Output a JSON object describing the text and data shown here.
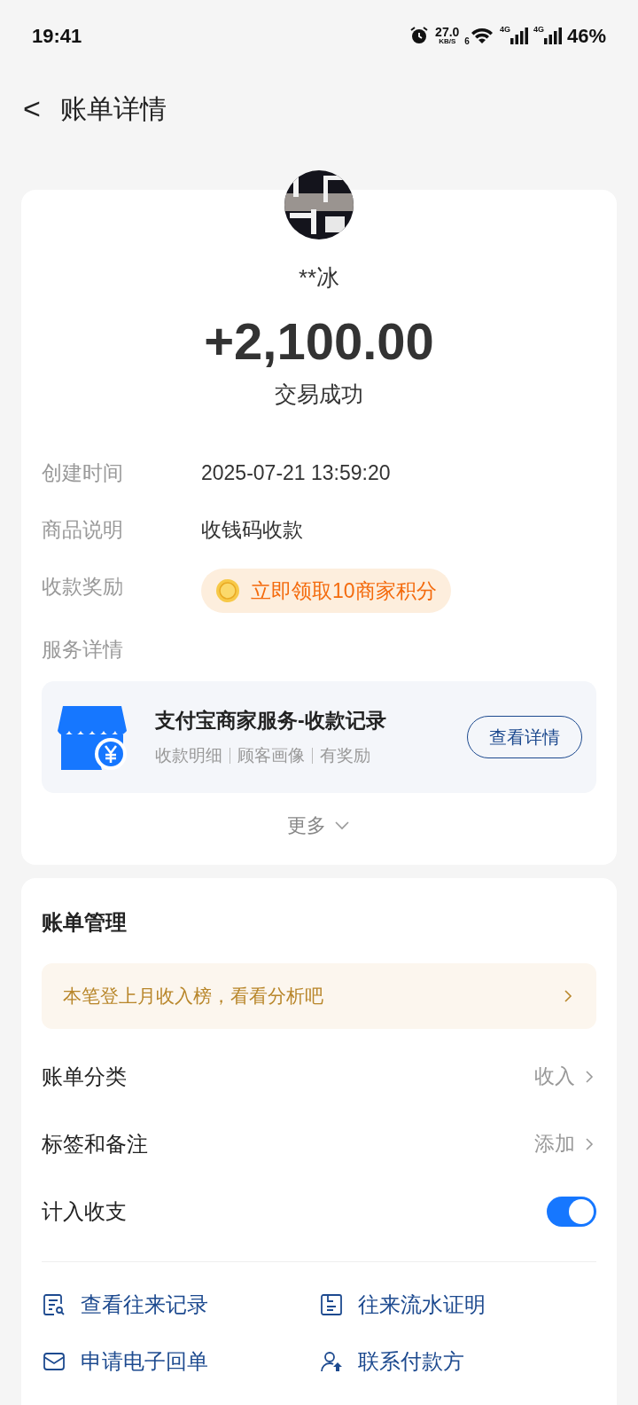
{
  "status_bar": {
    "time": "19:41",
    "speed": "27.0",
    "speed_unit": "KB/S",
    "wifi_label": "6",
    "network_labels": [
      "4G",
      "4G"
    ],
    "battery": "46%"
  },
  "header": {
    "back": "<",
    "title": "账单详情"
  },
  "summary": {
    "name": "**冰",
    "amount": "+2,100.00",
    "status": "交易成功"
  },
  "details": [
    {
      "kind": "text",
      "label": "创建时间",
      "value": "2025-07-21 13:59:20"
    },
    {
      "kind": "text",
      "label": "商品说明",
      "value": "收钱码收款"
    },
    {
      "kind": "reward",
      "label": "收款奖励",
      "value": "立即领取10商家积分"
    }
  ],
  "service": {
    "label": "服务详情",
    "title": "支付宝商家服务-收款记录",
    "tags": [
      "收款明细",
      "顾客画像",
      "有奖励"
    ],
    "button": "查看详情"
  },
  "more": "更多",
  "management": {
    "title": "账单管理",
    "banner": "本笔登上月收入榜，看看分析吧",
    "rows": [
      {
        "kind": "link",
        "label": "账单分类",
        "value": "收入"
      },
      {
        "kind": "link",
        "label": "标签和备注",
        "value": "添加"
      },
      {
        "kind": "toggle",
        "label": "计入收支",
        "on": true
      }
    ],
    "actions": [
      {
        "kind": "records",
        "label": "查看往来记录"
      },
      {
        "kind": "proof",
        "label": "往来流水证明"
      },
      {
        "kind": "receipt",
        "label": "申请电子回单"
      },
      {
        "kind": "contact",
        "label": "联系付款方"
      }
    ]
  }
}
